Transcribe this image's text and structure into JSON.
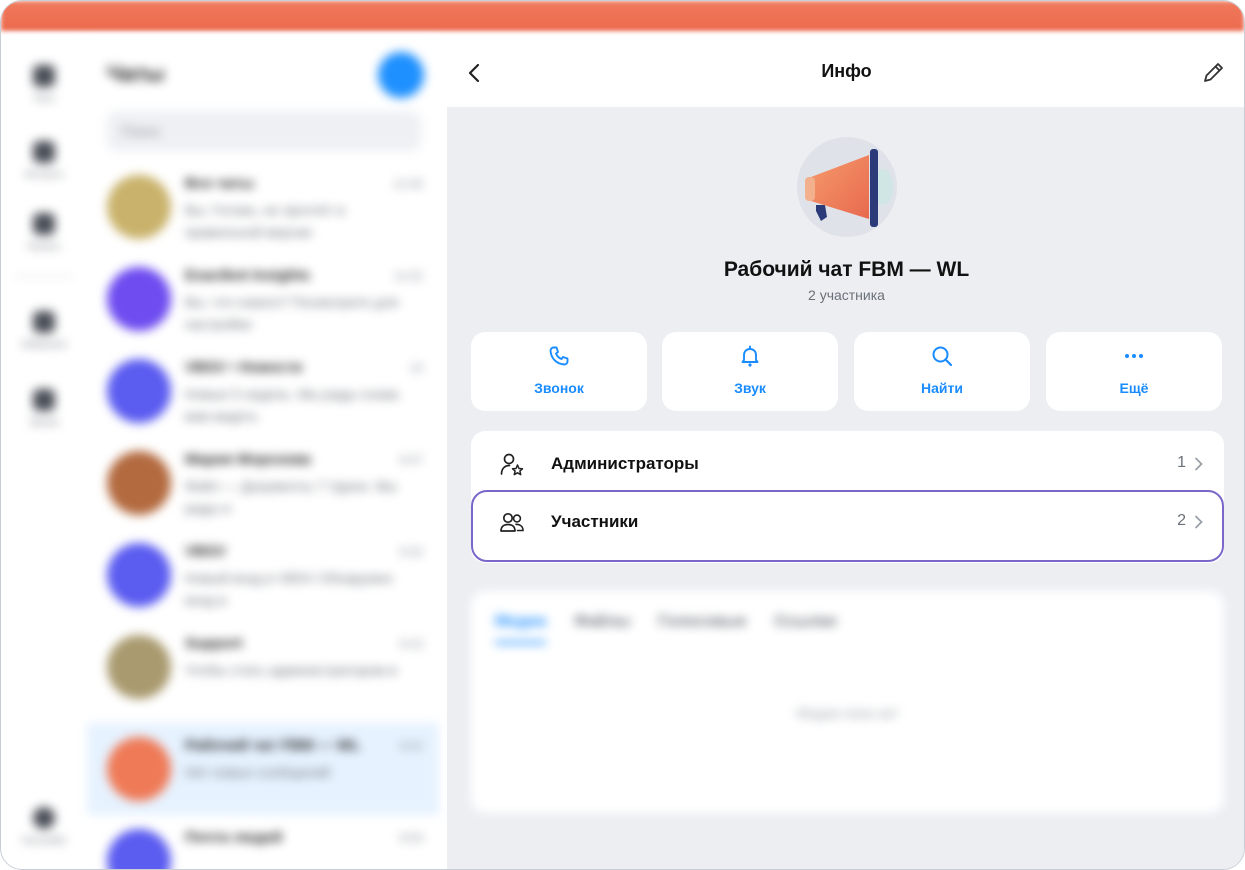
{
  "colors": {
    "accent": "#1a8cff",
    "titlebar": "#ec6a4e",
    "highlight_border": "#7a67c9",
    "page_bg": "#eceef2"
  },
  "rail": {
    "items": [
      {
        "icon": "chat-bubble-icon",
        "label": "Чаты"
      },
      {
        "icon": "contacts-icon",
        "label": "Контакты"
      },
      {
        "icon": "folder-icon",
        "label": "Каналы"
      },
      {
        "icon": "bookmark-icon",
        "label": "Избранное"
      },
      {
        "icon": "phone-icon",
        "label": "Звонки"
      },
      {
        "icon": "settings-icon",
        "label": "Настройки"
      }
    ]
  },
  "chatlist": {
    "title": "Чаты",
    "search_placeholder": "Поиск",
    "chats": [
      {
        "name": "Все чаты",
        "time": "12:45",
        "preview": "Вы: Готово, не прочтёт в правильной версии",
        "avatar_color": "#c9b26b"
      },
      {
        "name": "Exactbot Insights",
        "time": "11:52",
        "preview": "Вы: что нового? Посмотрите для настройки",
        "avatar_color": "#6e4cf0"
      },
      {
        "name": "VBSV • Новости",
        "time": "10",
        "preview": "Новые 5 недель. Мы рады снова вам видеть",
        "avatar_color": "#5b5cf0"
      },
      {
        "name": "Мария Морозова",
        "time": "9:47",
        "preview": "Файл — Документы 7 Удачи. Мы рады и",
        "avatar_color": "#b36a3f"
      },
      {
        "name": "VBSV",
        "time": "9:32",
        "preview": "Новый вход в VBSV Обнаружен вход в",
        "avatar_color": "#5b5cf0"
      },
      {
        "name": "Support",
        "time": "9:15",
        "preview": "Чтобы стать администратором в",
        "avatar_color": "#a99a6f"
      },
      {
        "name": "Рабочий чат FBM — WL",
        "time": "9:02",
        "preview": "Нет новых сообщений",
        "avatar_color": "#ef7a57"
      },
      {
        "name": "Почта людей",
        "time": "8:50",
        "preview": "",
        "avatar_color": "#5b5cf0"
      }
    ]
  },
  "info": {
    "title": "Инфо",
    "group_name": "Рабочий чат FBM — WL",
    "member_count_text": "2 участника",
    "actions": [
      {
        "icon": "phone-icon",
        "label": "Звонок"
      },
      {
        "icon": "bell-icon",
        "label": "Звук"
      },
      {
        "icon": "search-icon",
        "label": "Найти"
      },
      {
        "icon": "more-dots-icon",
        "label": "Ещё"
      }
    ],
    "rows": [
      {
        "icon": "admin-user-icon",
        "label": "Администраторы",
        "count": "1"
      },
      {
        "icon": "members-icon",
        "label": "Участники",
        "count": "2"
      }
    ],
    "media_tabs": [
      "Медиа",
      "Файлы",
      "Голосовые",
      "Ссылки"
    ],
    "media_empty": "Медиа пока нет"
  }
}
